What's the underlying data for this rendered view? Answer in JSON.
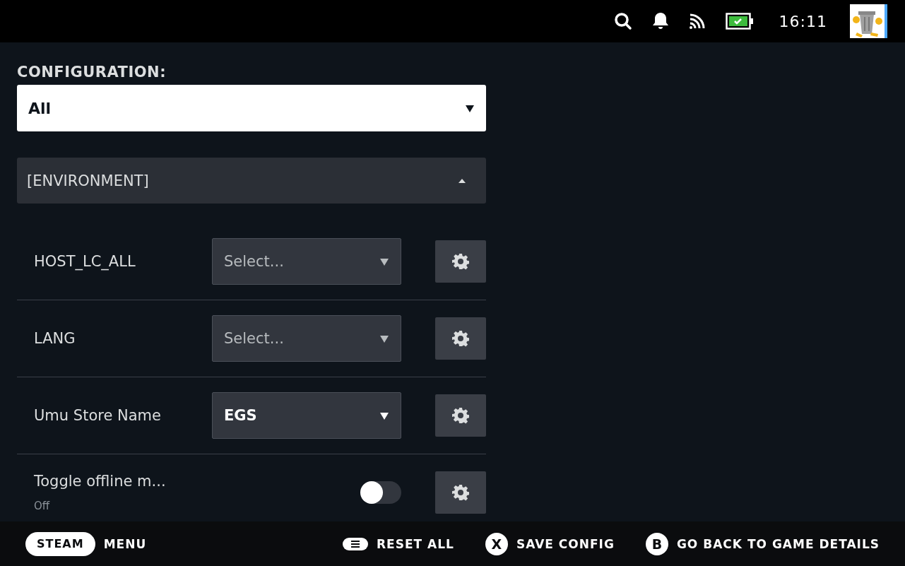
{
  "status_bar": {
    "time": "16:11"
  },
  "configuration": {
    "label": "CONFIGURATION:",
    "value": "All"
  },
  "section": {
    "title": "[ENVIRONMENT]",
    "expanded": true
  },
  "settings": [
    {
      "kind": "select",
      "label": "HOST_LC_ALL",
      "placeholder": "Select..."
    },
    {
      "kind": "select",
      "label": "LANG",
      "placeholder": "Select..."
    },
    {
      "kind": "select",
      "label": "Umu Store Name",
      "value": "EGS"
    },
    {
      "kind": "toggle",
      "label": "Toggle offline m...",
      "description": "Off",
      "on": false
    }
  ],
  "footer": {
    "steam": "STEAM",
    "menu": "MENU",
    "actions": [
      {
        "kind": "menu",
        "label": "RESET ALL"
      },
      {
        "kind": "letter",
        "key": "X",
        "label": "SAVE CONFIG"
      },
      {
        "kind": "letter",
        "key": "B",
        "label": "GO BACK TO GAME DETAILS"
      }
    ]
  }
}
